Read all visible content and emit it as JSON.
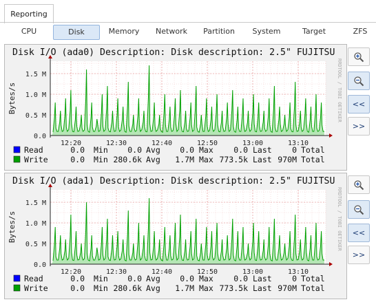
{
  "top_tab": "Reporting",
  "subtabs": [
    "CPU",
    "Disk",
    "Memory",
    "Network",
    "Partition",
    "System",
    "Target",
    "ZFS"
  ],
  "active_subtab": "Disk",
  "watermark": "RRDTOOL / TOBI OETIKER",
  "colors": {
    "read": "#0000ff",
    "write": "#00a000",
    "area": "#b5e6b5",
    "accent": "#93b4de"
  },
  "graphs": [
    {
      "title": "Disk I/O (ada0) Description: Disk description: 2.5\" FUJITSU",
      "ylabel": "Bytes/s",
      "yticks": [
        "0.0",
        "0.5 M",
        "1.0 M",
        "1.5 M"
      ],
      "xticks": [
        "12:20",
        "12:30",
        "12:40",
        "12:50",
        "13:00",
        "13:10"
      ],
      "legend": [
        {
          "label": "Read",
          "cur": "0.0",
          "min_label": "Min",
          "min": "0.0",
          "avg_label": "Avg",
          "avg": "0.0",
          "max_label": "Max",
          "max": "0.0",
          "last_label": "Last",
          "last": "0",
          "total_label": "Total"
        },
        {
          "label": "Write",
          "cur": "0.0",
          "min_label": "Min",
          "min": "280.6k",
          "avg_label": "Avg",
          "avg": "1.7M",
          "max_label": "Max",
          "max": "773.5k",
          "last_label": "Last",
          "last": "970M",
          "total_label": "Total"
        }
      ]
    },
    {
      "title": "Disk I/O (ada1) Description: Disk description: 2.5\" FUJITSU",
      "ylabel": "Bytes/s",
      "yticks": [
        "0.0",
        "0.5 M",
        "1.0 M",
        "1.5 M"
      ],
      "xticks": [
        "12:20",
        "12:30",
        "12:40",
        "12:50",
        "13:00",
        "13:10"
      ],
      "legend": [
        {
          "label": "Read",
          "cur": "0.0",
          "min_label": "Min",
          "min": "0.0",
          "avg_label": "Avg",
          "avg": "0.0",
          "max_label": "Max",
          "max": "0.0",
          "last_label": "Last",
          "last": "0",
          "total_label": "Total"
        },
        {
          "label": "Write",
          "cur": "0.0",
          "min_label": "Min",
          "min": "280.6k",
          "avg_label": "Avg",
          "avg": "1.7M",
          "max_label": "Max",
          "max": "773.5k",
          "last_label": "Last",
          "last": "970M",
          "total_label": "Total"
        }
      ]
    }
  ],
  "controls": [
    "zoom-in-icon",
    "zoom-out-icon",
    "<<",
    ">>"
  ],
  "chart_data": [
    {
      "type": "area",
      "title": "Disk I/O (ada0) Description: Disk description: 2.5\" FUJITSU",
      "ylabel": "Bytes/s",
      "ylim": [
        0,
        1.8
      ],
      "x": [
        "12:20",
        "12:30",
        "12:40",
        "12:50",
        "13:00",
        "13:10"
      ],
      "series": [
        {
          "name": "Read",
          "values": [
            0,
            0,
            0,
            0,
            0,
            0
          ]
        },
        {
          "name": "Write",
          "peaks_M": [
            0.8,
            0.6,
            0.9,
            1.1,
            0.7,
            0.5,
            1.6,
            0.8,
            0.4,
            1.0,
            1.2,
            0.6,
            0.9,
            0.7,
            1.3,
            0.5,
            0.9,
            0.6,
            1.7,
            0.8,
            0.5,
            1.0,
            0.7,
            0.9,
            1.1,
            0.6,
            0.8,
            1.2,
            0.5,
            0.9,
            0.7,
            1.0,
            0.6,
            0.8,
            1.1,
            0.7,
            0.9,
            0.6,
            1.0,
            0.8,
            0.6,
            0.9,
            1.2,
            0.7,
            0.5,
            0.8,
            1.3,
            0.6,
            0.9,
            0.7,
            1.0,
            0.8
          ]
        }
      ]
    },
    {
      "type": "area",
      "title": "Disk I/O (ada1) Description: Disk description: 2.5\" FUJITSU",
      "ylabel": "Bytes/s",
      "ylim": [
        0,
        1.8
      ],
      "x": [
        "12:20",
        "12:30",
        "12:40",
        "12:50",
        "13:00",
        "13:10"
      ],
      "series": [
        {
          "name": "Read",
          "values": [
            0,
            0,
            0,
            0,
            0,
            0
          ]
        },
        {
          "name": "Write",
          "peaks_M": [
            0.9,
            0.7,
            0.6,
            1.2,
            0.8,
            0.5,
            1.5,
            0.7,
            0.4,
            0.9,
            1.1,
            0.7,
            0.8,
            0.6,
            1.3,
            0.5,
            1.0,
            0.7,
            1.6,
            0.8,
            0.6,
            0.9,
            0.7,
            1.0,
            1.2,
            0.6,
            0.8,
            1.1,
            0.5,
            0.9,
            0.8,
            1.0,
            0.6,
            0.7,
            1.1,
            0.8,
            0.9,
            0.5,
            1.0,
            0.8,
            0.6,
            0.9,
            1.1,
            0.7,
            0.5,
            0.8,
            1.2,
            0.6,
            0.9,
            0.7,
            1.0,
            0.8
          ]
        }
      ]
    }
  ]
}
